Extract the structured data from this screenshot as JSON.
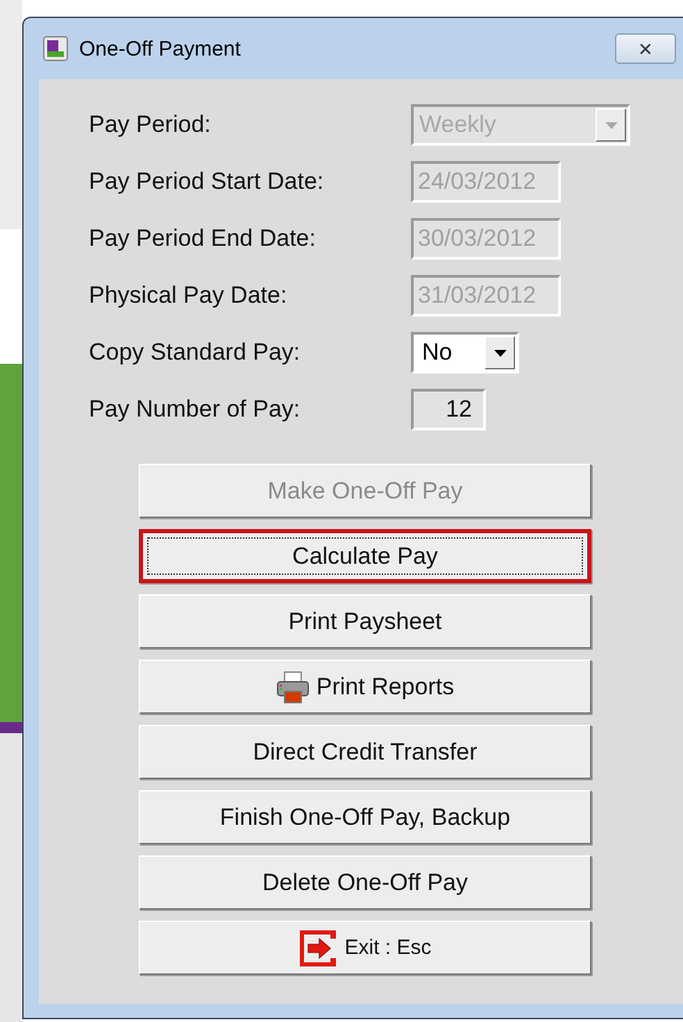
{
  "window": {
    "title": "One-Off Payment",
    "close": "✕"
  },
  "fields": [
    {
      "label": "Pay Period:",
      "kind": "dropdown",
      "value": "Weekly",
      "disabled": true
    },
    {
      "label": "Pay Period Start Date:",
      "kind": "text",
      "value": "24/03/2012",
      "disabled": true
    },
    {
      "label": "Pay Period End Date:",
      "kind": "text",
      "value": "30/03/2012",
      "disabled": true
    },
    {
      "label": "Physical Pay Date:",
      "kind": "text",
      "value": "31/03/2012",
      "disabled": true
    },
    {
      "label": "Copy Standard Pay:",
      "kind": "dropdown",
      "value": "No",
      "disabled": false
    },
    {
      "label": "Pay Number of Pay:",
      "kind": "number",
      "value": "12",
      "disabled": true
    }
  ],
  "buttons": [
    {
      "label": "Make One-Off Pay",
      "disabled": true,
      "selected": false,
      "kind": "plain"
    },
    {
      "label": "Calculate Pay",
      "disabled": false,
      "selected": true,
      "kind": "plain"
    },
    {
      "label": "Print Paysheet",
      "disabled": false,
      "selected": false,
      "kind": "plain"
    },
    {
      "label": "Print Reports",
      "disabled": false,
      "selected": false,
      "kind": "printer"
    },
    {
      "label": "Direct Credit Transfer",
      "disabled": false,
      "selected": false,
      "kind": "plain"
    },
    {
      "label": "Finish One-Off Pay, Backup",
      "disabled": false,
      "selected": false,
      "kind": "plain"
    },
    {
      "label": "Delete One-Off Pay",
      "disabled": false,
      "selected": false,
      "kind": "plain"
    },
    {
      "label": "Exit : Esc",
      "disabled": false,
      "selected": false,
      "kind": "exit"
    }
  ]
}
